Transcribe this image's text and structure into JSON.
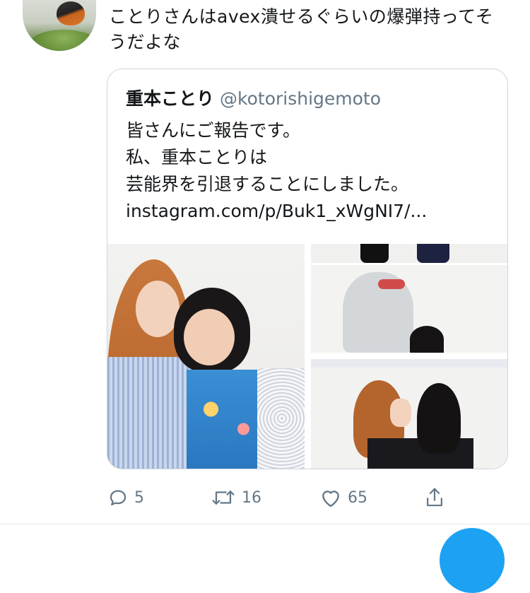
{
  "tweet": {
    "text": "ことりさんはavex潰せるぐらいの爆弾持ってそうだよな"
  },
  "quoted_tweet": {
    "display_name": "重本ことり",
    "handle": "@kotorishigemoto",
    "lines": [
      "皆さんにご報告です。",
      "私、重本ことりは",
      "芸能界を引退することにしました。",
      "instagram.com/p/Buk1_xWgNI7/..."
    ]
  },
  "actions": {
    "reply_count": "5",
    "retweet_count": "16",
    "like_count": "65"
  },
  "colors": {
    "accent": "#1da1f2",
    "secondary_text": "#657786",
    "border": "#ccd6dd"
  }
}
